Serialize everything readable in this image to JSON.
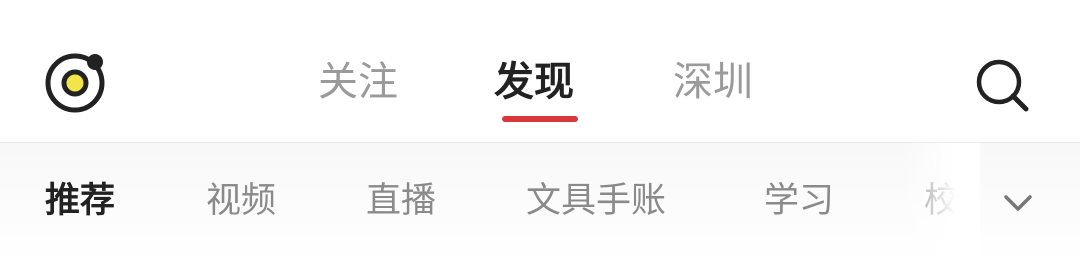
{
  "top_nav": {
    "tabs": [
      {
        "label": "关注",
        "active": false
      },
      {
        "label": "发现",
        "active": true
      },
      {
        "label": "深圳",
        "active": false
      }
    ]
  },
  "category_bar": {
    "items": [
      {
        "label": "推荐",
        "active": true
      },
      {
        "label": "视频",
        "active": false
      },
      {
        "label": "直播",
        "active": false
      },
      {
        "label": "文具手账",
        "active": false
      },
      {
        "label": "学习",
        "active": false
      },
      {
        "label": "校园",
        "active": false
      }
    ]
  },
  "icons": {
    "logo": "camera-lens-logo-icon",
    "search": "search-icon",
    "expand": "chevron-down-icon"
  },
  "colors": {
    "accent": "#d8383c",
    "logo_yellow": "#f2e54a",
    "text_active": "#222222",
    "text_inactive": "#9a9a9a"
  }
}
